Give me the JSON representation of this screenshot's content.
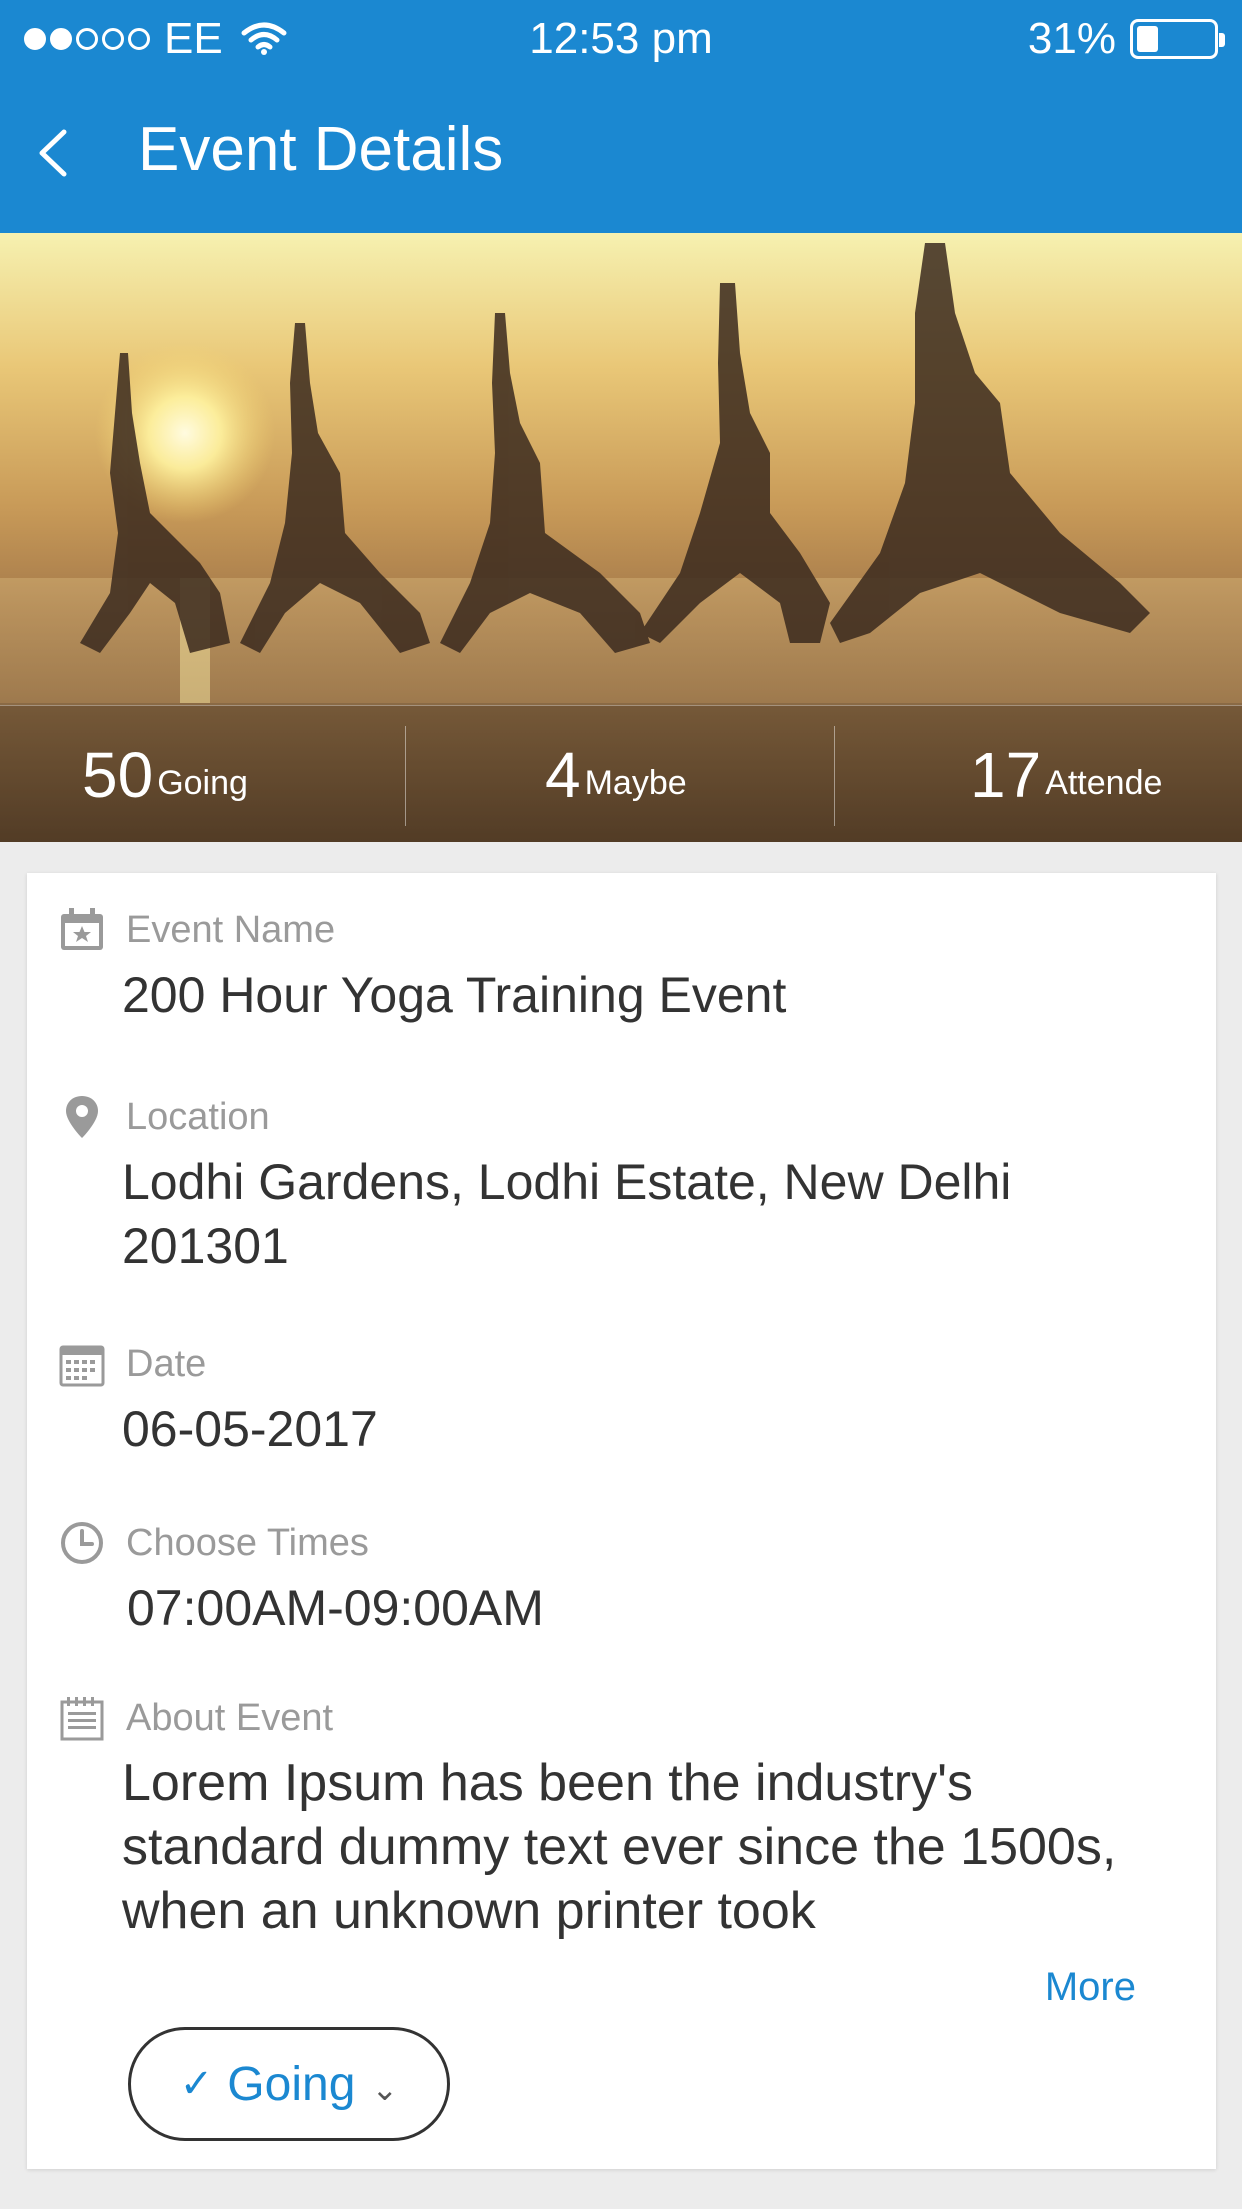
{
  "status_bar": {
    "carrier": "EE",
    "time": "12:53 pm",
    "battery": "31%",
    "signal_icon": "signal-dots-icon",
    "wifi_icon": "wifi-icon",
    "battery_icon": "battery-icon"
  },
  "header": {
    "title": "Event Details",
    "back_icon": "chevron-left-icon"
  },
  "hero": {
    "image": "yoga-group-sunset-beach",
    "stats": [
      {
        "count": "50",
        "label": "Going"
      },
      {
        "count": "4",
        "label": "Maybe"
      },
      {
        "count": "17",
        "label": "Attende"
      }
    ]
  },
  "details": {
    "event_name": {
      "label": "Event Name",
      "value": "200 Hour Yoga Training Event",
      "icon": "calendar-star-icon"
    },
    "location": {
      "label": "Location",
      "value": "Lodhi Gardens, Lodhi Estate, New Delhi 201301",
      "icon": "map-pin-icon"
    },
    "date": {
      "label": "Date",
      "value": "06-05-2017",
      "icon": "calendar-grid-icon"
    },
    "times": {
      "label": "Choose Times",
      "value": "07:00AM-09:00AM",
      "icon": "clock-icon"
    },
    "about": {
      "label": "About Event",
      "value": "Lorem Ipsum has been the industry's standard dummy text ever since the 1500s, when an unknown printer took",
      "icon": "notepad-icon"
    },
    "more_label": "More"
  },
  "rsvp": {
    "label": "Going",
    "check_icon": "check-icon",
    "dropdown_icon": "chevron-down-icon"
  },
  "colors": {
    "accent": "#1b88d1"
  }
}
